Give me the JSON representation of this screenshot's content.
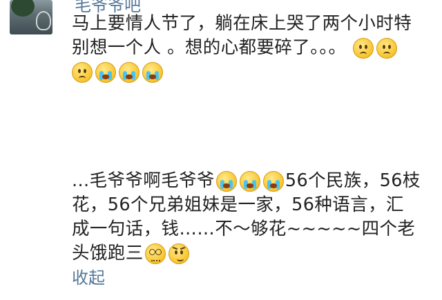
{
  "author": {
    "name": "毛爷爷吧"
  },
  "comment1": {
    "line1": "马上要情人节了，躺在床上哭了两个小时特",
    "line2": "别想一个人 。想的心都要碎了。。。"
  },
  "comment2": {
    "line1_text": "...毛爷爷啊毛爷爷",
    "line1_tail": "56个民族，56枝",
    "line2": "花，56个兄弟姐妹是一家，56种语言，汇",
    "line3": "成一句话，钱……不～够花~~~~~四个老",
    "line4": "头饿跑三"
  },
  "actions": {
    "collapse_label": "收起"
  },
  "icons": {
    "sad": "sad-face-icon",
    "crying": "crying-face-icon",
    "dizzy": "dizzy-face-icon",
    "smirk": "smirk-face-icon"
  }
}
